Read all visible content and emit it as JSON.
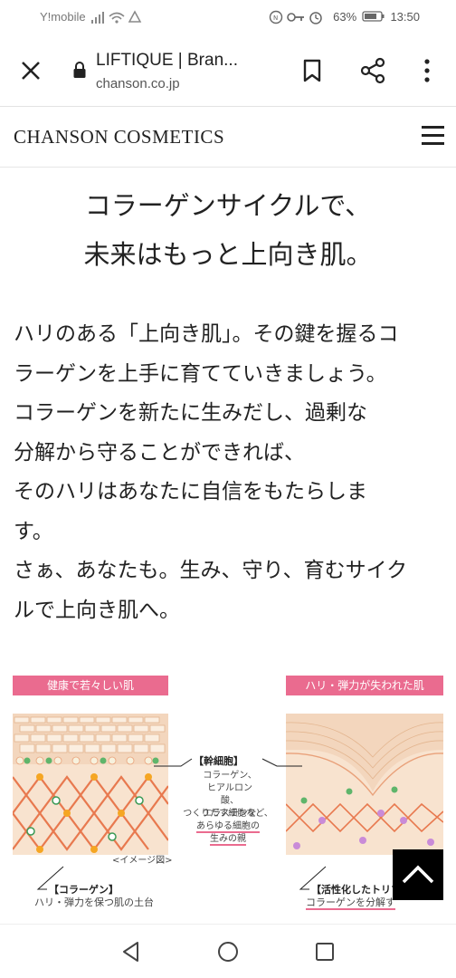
{
  "status_bar": {
    "carrier": "Y!mobile",
    "battery": "63%",
    "time": "13:50"
  },
  "browser": {
    "title": "LIFTIQUE | Bran...",
    "url": "chanson.co.jp"
  },
  "site": {
    "brand": "CHANSON COSMETICS"
  },
  "headline": {
    "line1": "コラーゲンサイクルで、",
    "line2": "未来はもっと上向き肌。"
  },
  "body": {
    "lines": [
      "ハリのある「上向き肌」。その鍵を握るコ",
      "ラーゲンを上手に育てていきましょう。",
      "コラーゲンを新たに生みだし、過剰な",
      "分解から守ることができれば、",
      "そのハリはあなたに自信をもたらしま",
      "す。",
      "さぁ、あなたも。生み、守り、育むサイク",
      "ルで上向き肌へ。"
    ]
  },
  "illustration": {
    "left_label": "健康で若々しい肌",
    "right_label": "ハリ・弾力が失われた肌",
    "stem_title": "【幹細胞】",
    "stem_lines": [
      "コラーゲン、",
      "ヒアルロン酸、",
      "エラスチンを",
      "つくりだす細胞など、",
      "あらゆる細胞の",
      "生みの親"
    ],
    "image_note": "<イメージ図>",
    "collagen_title": "【コラーゲン】",
    "collagen_desc": "ハリ・弾力を保つ肌の土台",
    "tri_title": "【活性化したトリプ",
    "tri_desc": "コラーゲンを分解す"
  },
  "colors": {
    "accent_pink": "#ea6b8f",
    "skin": "#f7dcc0"
  }
}
